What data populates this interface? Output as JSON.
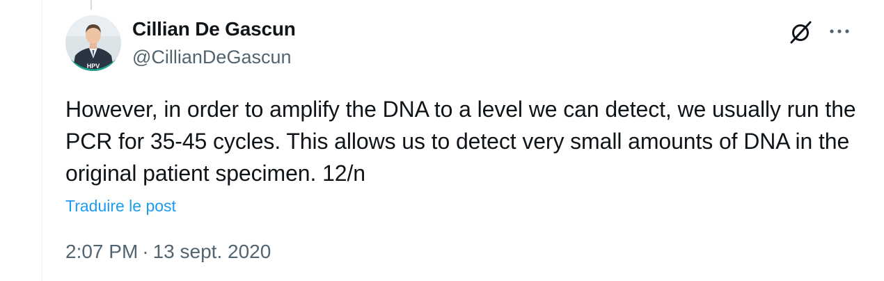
{
  "author": {
    "name": "Cillian De Gascun",
    "handle": "@CillianDeGascun",
    "avatar_badge": "HPV"
  },
  "tweet": {
    "text": "However, in order to amplify the DNA to a level we can detect, we usually run the PCR for 35-45 cycles. This allows us to detect very small amounts of DNA in the original patient specimen. 12/n",
    "translate_label": "Traduire le post"
  },
  "meta": {
    "time": "2:07 PM",
    "separator": "·",
    "date": "13 sept. 2020"
  },
  "icons": {
    "grok": "grok-icon",
    "more": "more-icon"
  },
  "colors": {
    "text_primary": "#0f1419",
    "text_secondary": "#536471",
    "link": "#1d9bf0",
    "badge": "#1aa891"
  }
}
